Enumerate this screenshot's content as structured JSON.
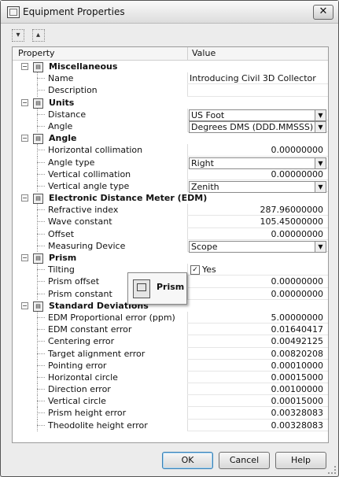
{
  "window": {
    "title": "Equipment Properties",
    "close_label": "✕"
  },
  "toolbar": {
    "btn1": "▾",
    "btn2": "▴"
  },
  "grid": {
    "header_property": "Property",
    "header_value": "Value"
  },
  "tooltip": {
    "label": "Prism"
  },
  "rows": [
    {
      "kind": "cat",
      "name": "Miscellaneous"
    },
    {
      "kind": "prop",
      "name": "Name",
      "value": "Introducing Civil 3D Collector",
      "align": "left"
    },
    {
      "kind": "prop",
      "name": "Description",
      "value": "",
      "align": "left"
    },
    {
      "kind": "cat",
      "name": "Units"
    },
    {
      "kind": "prop",
      "name": "Distance",
      "value": "US Foot",
      "control": "dropdown"
    },
    {
      "kind": "prop",
      "name": "Angle",
      "value": "Degrees DMS (DDD.MMSSS)",
      "control": "dropdown"
    },
    {
      "kind": "cat",
      "name": "Angle"
    },
    {
      "kind": "prop",
      "name": "Horizontal collimation",
      "value": "0.00000000",
      "align": "right"
    },
    {
      "kind": "prop",
      "name": "Angle type",
      "value": "Right",
      "control": "dropdown"
    },
    {
      "kind": "prop",
      "name": "Vertical collimation",
      "value": "0.00000000",
      "align": "right"
    },
    {
      "kind": "prop",
      "name": "Vertical angle type",
      "value": "Zenith",
      "control": "dropdown"
    },
    {
      "kind": "cat",
      "name": "Electronic Distance Meter (EDM)"
    },
    {
      "kind": "prop",
      "name": "Refractive index",
      "value": "287.96000000",
      "align": "right"
    },
    {
      "kind": "prop",
      "name": "Wave constant",
      "value": "105.45000000",
      "align": "right"
    },
    {
      "kind": "prop",
      "name": "Offset",
      "value": "0.00000000",
      "align": "right"
    },
    {
      "kind": "prop",
      "name": "Measuring Device",
      "value": "Scope",
      "control": "dropdown"
    },
    {
      "kind": "cat",
      "name": "Prism"
    },
    {
      "kind": "prop",
      "name": "Tilting",
      "value": "Yes",
      "control": "checkbox",
      "checked": true
    },
    {
      "kind": "prop",
      "name": "Prism offset",
      "value": "0.00000000",
      "align": "right"
    },
    {
      "kind": "prop",
      "name": "Prism constant",
      "value": "0.00000000",
      "align": "right"
    },
    {
      "kind": "cat",
      "name": "Standard Deviations"
    },
    {
      "kind": "prop",
      "name": "EDM Proportional error (ppm)",
      "value": "5.00000000",
      "align": "right"
    },
    {
      "kind": "prop",
      "name": "EDM constant error",
      "value": "0.01640417",
      "align": "right"
    },
    {
      "kind": "prop",
      "name": "Centering error",
      "value": "0.00492125",
      "align": "right"
    },
    {
      "kind": "prop",
      "name": "Target alignment error",
      "value": "0.00820208",
      "align": "right"
    },
    {
      "kind": "prop",
      "name": "Pointing error",
      "value": "0.00010000",
      "align": "right"
    },
    {
      "kind": "prop",
      "name": "Horizontal circle",
      "value": "0.00015000",
      "align": "right"
    },
    {
      "kind": "prop",
      "name": "Direction error",
      "value": "0.00100000",
      "align": "right"
    },
    {
      "kind": "prop",
      "name": "Vertical circle",
      "value": "0.00015000",
      "align": "right"
    },
    {
      "kind": "prop",
      "name": "Prism height error",
      "value": "0.00328083",
      "align": "right"
    },
    {
      "kind": "prop",
      "name": "Theodolite height error",
      "value": "0.00328083",
      "align": "right"
    }
  ],
  "buttons": {
    "ok": "OK",
    "cancel": "Cancel",
    "help": "Help"
  }
}
